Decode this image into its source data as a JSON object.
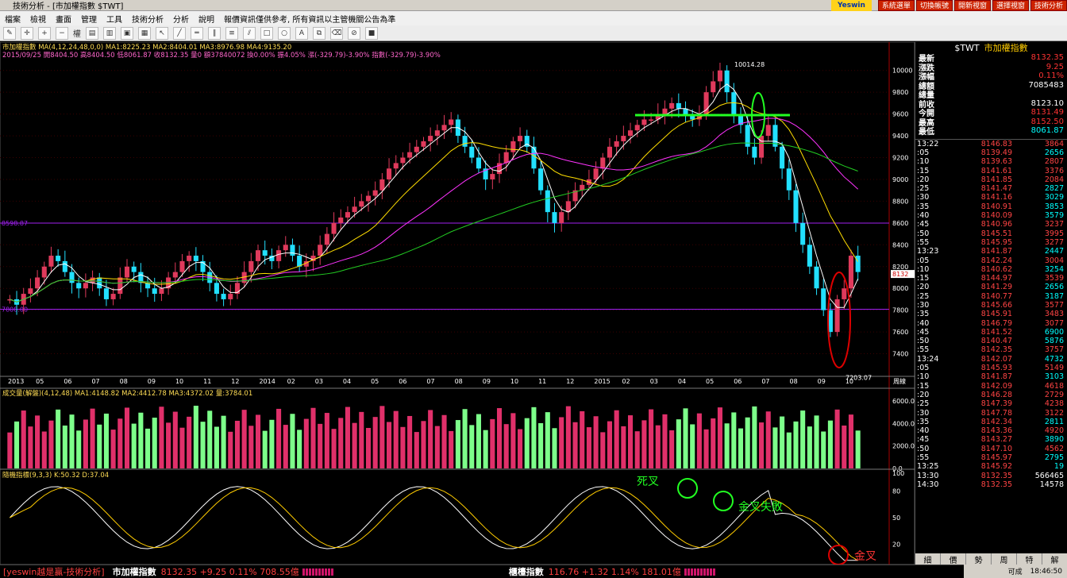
{
  "window": {
    "title": "技術分析 - [市加權指數 $TWT]"
  },
  "topbar": {
    "logo": "Yeswin",
    "buttons": [
      "系統選單",
      "切換帳號",
      "開新視窗",
      "選擇視窗",
      "技術分析"
    ]
  },
  "menu": [
    "檔案",
    "檢視",
    "畫面",
    "管理",
    "工具",
    "技術分析",
    "分析",
    "說明",
    "報價資訊僅供參考, 所有資訊以主管機關公告為準"
  ],
  "toolbar": {
    "period_label": "權"
  },
  "chart": {
    "header1": "市加權指數 MA(4,12,24,48,0,0) MA1:8225.23 MA2:8404.01 MA3:8976.98 MA4:9135.20",
    "header2": "2015/09/25 開8404.50 高8404.50 低8061.87 收8132.35 量0 額37840072 換0.00% 振4.05% 漲(-329.79)-3.90% 指數(-329.79)-3.90%",
    "y_labels": [
      "10000",
      "9800",
      "9600",
      "9400",
      "9200",
      "9000",
      "8800",
      "8600",
      "8400",
      "8200",
      "8000",
      "7800",
      "7600",
      "7400"
    ],
    "x_labels": [
      "2013",
      "05",
      "06",
      "07",
      "08",
      "09",
      "10",
      "11",
      "12",
      "2014",
      "02",
      "03",
      "04",
      "05",
      "06",
      "07",
      "08",
      "09",
      "10",
      "11",
      "12",
      "2015",
      "02",
      "03",
      "04",
      "05",
      "06",
      "07",
      "08",
      "09",
      "10"
    ],
    "x_unit": "周線",
    "level_high": "8598.87",
    "level_low": "7808.00",
    "peak_label": "10014.28",
    "low_label": "7203.07",
    "last_price": "8132",
    "volume_header": "成交量(解盤)(4,12,48) MA1:4148.82 MA2:4412.78 MA3:4372.02 量:3784.01",
    "volume_y": [
      "6000.0",
      "4000.0",
      "2000.0",
      "0.0"
    ],
    "kd_header": "隨機指標(9,3,3) K:50.32 D:37.04",
    "kd_y": [
      "100",
      "80",
      "50",
      "20"
    ],
    "annotations": {
      "death": "死叉",
      "golden_fail": "金叉失敗",
      "golden": "金叉"
    }
  },
  "side": {
    "symbol": "$TWT",
    "name": "市加權指數",
    "quote": [
      {
        "label": "最新",
        "value": "8132.35",
        "color": "#ff3333"
      },
      {
        "label": "漲跌",
        "value": "9.25",
        "color": "#ff3333"
      },
      {
        "label": "漲幅",
        "value": "0.11%",
        "color": "#ff3333"
      },
      {
        "label": "總額",
        "value": "7085483",
        "color": "#fff"
      },
      {
        "label": "總量",
        "value": "",
        "color": "#fff"
      },
      {
        "label": "前收",
        "value": "8123.10",
        "color": "#fff"
      },
      {
        "label": "今開",
        "value": "8131.49",
        "color": "#ff3333"
      },
      {
        "label": "最高",
        "value": "8152.50",
        "color": "#ff3333"
      },
      {
        "label": "最低",
        "value": "8061.87",
        "color": "#00ffff"
      }
    ],
    "ticks": [
      {
        "t": "13:22",
        "p": "8146.83",
        "v": "3864",
        "vc": "#ff4444"
      },
      {
        "t": ":05",
        "p": "8139.49",
        "v": "2656",
        "vc": "#00ffff"
      },
      {
        "t": ":10",
        "p": "8139.63",
        "v": "2807",
        "vc": "#ff4444"
      },
      {
        "t": ":15",
        "p": "8141.61",
        "v": "3376",
        "vc": "#ff4444"
      },
      {
        "t": ":20",
        "p": "8141.85",
        "v": "2084",
        "vc": "#ff4444"
      },
      {
        "t": ":25",
        "p": "8141.47",
        "v": "2827",
        "vc": "#00ffff"
      },
      {
        "t": ":30",
        "p": "8141.16",
        "v": "3029",
        "vc": "#00ffff"
      },
      {
        "t": ":35",
        "p": "8140.91",
        "v": "3853",
        "vc": "#00ffff"
      },
      {
        "t": ":40",
        "p": "8140.09",
        "v": "3579",
        "vc": "#00ffff"
      },
      {
        "t": ":45",
        "p": "8140.96",
        "v": "3237",
        "vc": "#ff4444"
      },
      {
        "t": ":50",
        "p": "8145.51",
        "v": "3995",
        "vc": "#ff4444"
      },
      {
        "t": ":55",
        "p": "8145.95",
        "v": "3277",
        "vc": "#ff4444"
      },
      {
        "t": "13:23",
        "p": "8141.87",
        "v": "2447",
        "vc": "#00ffff"
      },
      {
        "t": ":05",
        "p": "8142.24",
        "v": "3004",
        "vc": "#ff4444"
      },
      {
        "t": ":10",
        "p": "8140.62",
        "v": "3254",
        "vc": "#00ffff"
      },
      {
        "t": ":15",
        "p": "8144.97",
        "v": "3539",
        "vc": "#ff4444"
      },
      {
        "t": ":20",
        "p": "8141.29",
        "v": "2656",
        "vc": "#00ffff"
      },
      {
        "t": ":25",
        "p": "8140.77",
        "v": "3187",
        "vc": "#00ffff"
      },
      {
        "t": ":30",
        "p": "8145.66",
        "v": "3577",
        "vc": "#ff4444"
      },
      {
        "t": ":35",
        "p": "8145.91",
        "v": "3483",
        "vc": "#ff4444"
      },
      {
        "t": ":40",
        "p": "8146.79",
        "v": "3077",
        "vc": "#ff4444"
      },
      {
        "t": ":45",
        "p": "8141.52",
        "v": "6900",
        "vc": "#00ffff"
      },
      {
        "t": ":50",
        "p": "8140.47",
        "v": "5876",
        "vc": "#00ffff"
      },
      {
        "t": ":55",
        "p": "8142.35",
        "v": "3757",
        "vc": "#ff4444"
      },
      {
        "t": "13:24",
        "p": "8142.07",
        "v": "4732",
        "vc": "#00ffff"
      },
      {
        "t": ":05",
        "p": "8145.93",
        "v": "5149",
        "vc": "#ff4444"
      },
      {
        "t": ":10",
        "p": "8141.87",
        "v": "3103",
        "vc": "#00ffff"
      },
      {
        "t": ":15",
        "p": "8142.09",
        "v": "4618",
        "vc": "#ff4444"
      },
      {
        "t": ":20",
        "p": "8146.28",
        "v": "2729",
        "vc": "#ff4444"
      },
      {
        "t": ":25",
        "p": "8147.39",
        "v": "4238",
        "vc": "#ff4444"
      },
      {
        "t": ":30",
        "p": "8147.78",
        "v": "3122",
        "vc": "#ff4444"
      },
      {
        "t": ":35",
        "p": "8142.34",
        "v": "2811",
        "vc": "#00ffff"
      },
      {
        "t": ":40",
        "p": "8143.36",
        "v": "4920",
        "vc": "#ff4444"
      },
      {
        "t": ":45",
        "p": "8143.27",
        "v": "3890",
        "vc": "#00ffff"
      },
      {
        "t": ":50",
        "p": "8147.10",
        "v": "4562",
        "vc": "#ff4444"
      },
      {
        "t": ":55",
        "p": "8145.97",
        "v": "2795",
        "vc": "#00ffff"
      },
      {
        "t": "13:25",
        "p": "8145.92",
        "v": "19",
        "vc": "#00ffff"
      },
      {
        "t": "13:30",
        "p": "8132.35",
        "v": "566465",
        "vc": "#fff"
      },
      {
        "t": "14:30",
        "p": "8132.35",
        "v": "14578",
        "vc": "#fff"
      }
    ],
    "tabs": [
      "細",
      "價",
      "勢",
      "周",
      "特",
      "解"
    ]
  },
  "status": {
    "app": "[yeswin越是贏-技術分析]",
    "idx1_name": "市加權指數",
    "idx1_val": "8132.35 +9.25 0.11% 708.55億",
    "idx2_name": "櫃檯指數",
    "idx2_val": "116.76 +1.32 1.14% 181.01億",
    "mode": "可成",
    "clock": "18:46:50"
  }
}
